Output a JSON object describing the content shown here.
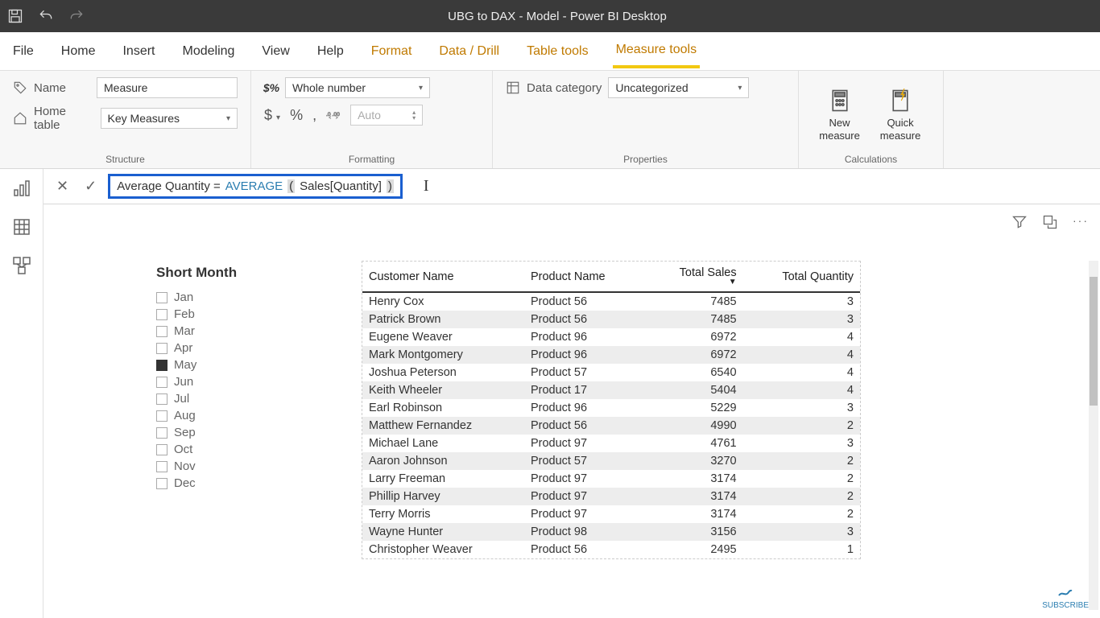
{
  "titlebar": {
    "title": "UBG to DAX - Model - Power BI Desktop"
  },
  "tabs": {
    "file": "File",
    "home": "Home",
    "insert": "Insert",
    "modeling": "Modeling",
    "view": "View",
    "help": "Help",
    "format": "Format",
    "datadrill": "Data / Drill",
    "tabletools": "Table tools",
    "measuretools": "Measure tools"
  },
  "ribbon": {
    "structure": {
      "label": "Structure",
      "name_label": "Name",
      "name_value": "Measure",
      "hometable_label": "Home table",
      "hometable_value": "Key Measures"
    },
    "formatting": {
      "label": "Formatting",
      "format_value": "Whole number",
      "auto": "Auto",
      "dollar": "$",
      "percent": "%",
      "comma": ","
    },
    "properties": {
      "label": "Properties",
      "datacat_label": "Data category",
      "datacat_value": "Uncategorized"
    },
    "calculations": {
      "label": "Calculations",
      "new_measure": "New measure",
      "quick_measure": "Quick measure"
    }
  },
  "formula": {
    "prefix": "Average Quantity = ",
    "fn": "AVERAGE",
    "arg": " Sales[Quantity] "
  },
  "slicer": {
    "title": "Short Month",
    "items": [
      {
        "label": "Jan",
        "checked": false
      },
      {
        "label": "Feb",
        "checked": false
      },
      {
        "label": "Mar",
        "checked": false
      },
      {
        "label": "Apr",
        "checked": false
      },
      {
        "label": "May",
        "checked": true
      },
      {
        "label": "Jun",
        "checked": false
      },
      {
        "label": "Jul",
        "checked": false
      },
      {
        "label": "Aug",
        "checked": false
      },
      {
        "label": "Sep",
        "checked": false
      },
      {
        "label": "Oct",
        "checked": false
      },
      {
        "label": "Nov",
        "checked": false
      },
      {
        "label": "Dec",
        "checked": false
      }
    ]
  },
  "table": {
    "headers": [
      "Customer Name",
      "Product Name",
      "Total Sales",
      "Total Quantity"
    ],
    "rows": [
      {
        "c": "Henry Cox",
        "p": "Product 56",
        "s": 7485,
        "q": 3
      },
      {
        "c": "Patrick Brown",
        "p": "Product 56",
        "s": 7485,
        "q": 3
      },
      {
        "c": "Eugene Weaver",
        "p": "Product 96",
        "s": 6972,
        "q": 4
      },
      {
        "c": "Mark Montgomery",
        "p": "Product 96",
        "s": 6972,
        "q": 4
      },
      {
        "c": "Joshua Peterson",
        "p": "Product 57",
        "s": 6540,
        "q": 4
      },
      {
        "c": "Keith Wheeler",
        "p": "Product 17",
        "s": 5404,
        "q": 4
      },
      {
        "c": "Earl Robinson",
        "p": "Product 96",
        "s": 5229,
        "q": 3
      },
      {
        "c": "Matthew Fernandez",
        "p": "Product 56",
        "s": 4990,
        "q": 2
      },
      {
        "c": "Michael Lane",
        "p": "Product 97",
        "s": 4761,
        "q": 3
      },
      {
        "c": "Aaron Johnson",
        "p": "Product 57",
        "s": 3270,
        "q": 2
      },
      {
        "c": "Larry Freeman",
        "p": "Product 97",
        "s": 3174,
        "q": 2
      },
      {
        "c": "Phillip Harvey",
        "p": "Product 97",
        "s": 3174,
        "q": 2
      },
      {
        "c": "Terry Morris",
        "p": "Product 97",
        "s": 3174,
        "q": 2
      },
      {
        "c": "Wayne Hunter",
        "p": "Product 98",
        "s": 3156,
        "q": 3
      },
      {
        "c": "Christopher Weaver",
        "p": "Product 56",
        "s": 2495,
        "q": 1
      }
    ]
  },
  "subscribe": "SUBSCRIBE"
}
